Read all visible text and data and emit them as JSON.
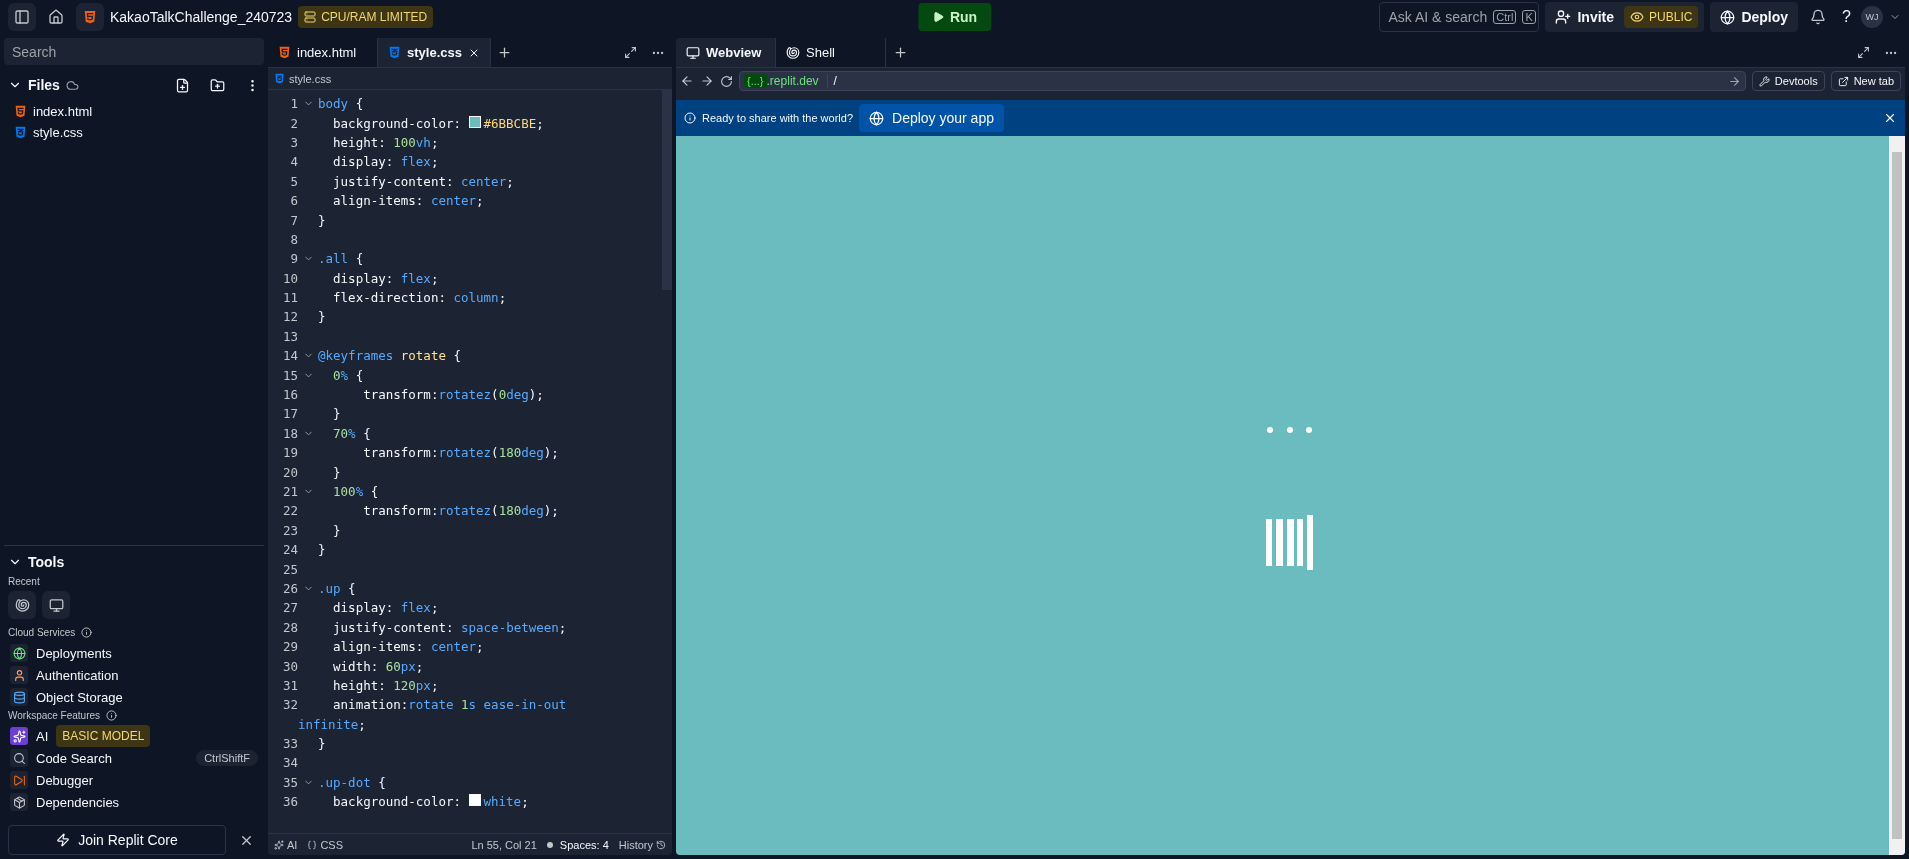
{
  "topbar": {
    "project": "KakaoTalkChallenge_240723",
    "badge": "CPU/RAM LIMITED",
    "run": "Run",
    "search": {
      "placeholder": "Ask AI & search",
      "keys": [
        "Ctrl",
        "K"
      ]
    },
    "invite": "Invite",
    "visibility": "PUBLIC",
    "deploy": "Deploy",
    "help": "?",
    "avatar": "WJ"
  },
  "sidebar": {
    "search": {
      "placeholder": "Search"
    },
    "files_title": "Files",
    "files": [
      {
        "name": "index.html",
        "kind": "html"
      },
      {
        "name": "style.css",
        "kind": "css"
      }
    ],
    "tools_title": "Tools",
    "recent_label": "Recent",
    "recent": [
      {
        "kind": "shell"
      },
      {
        "kind": "webview"
      }
    ],
    "sections": [
      {
        "title": "Cloud Services",
        "items": [
          {
            "label": "Deployments",
            "kind": "deploy"
          },
          {
            "label": "Authentication",
            "kind": "auth"
          },
          {
            "label": "Object Storage",
            "kind": "storage"
          }
        ]
      },
      {
        "title": "Workspace Features",
        "items": [
          {
            "label": "AI",
            "kind": "ai",
            "badge": "BASIC MODEL"
          },
          {
            "label": "Code Search",
            "kind": "search",
            "shortcut": "CtrlShiftF"
          },
          {
            "label": "Debugger",
            "kind": "debug"
          },
          {
            "label": "Dependencies",
            "kind": "deps"
          }
        ]
      }
    ],
    "join": "Join Replit Core"
  },
  "editor": {
    "tabs": [
      {
        "label": "index.html",
        "kind": "html",
        "selected": false
      },
      {
        "label": "style.css",
        "kind": "css",
        "selected": true
      }
    ],
    "breadcrumb": "style.css",
    "lines": [
      {
        "n": "1",
        "fold": true,
        "tokens": [
          {
            "kind": "sel",
            "text": "body"
          },
          {
            "kind": "p",
            "text": " {"
          }
        ]
      },
      {
        "n": "2",
        "fold": false,
        "tokens": [
          {
            "kind": "p",
            "text": "  background-color: "
          },
          {
            "kind": "swatch",
            "color": "#6bbcbe"
          },
          {
            "kind": "hex",
            "text": "#6BBCBE"
          },
          {
            "kind": "p",
            "text": ";"
          }
        ]
      },
      {
        "n": "3",
        "fold": false,
        "tokens": [
          {
            "kind": "p",
            "text": "  height: "
          },
          {
            "kind": "num",
            "text": "100"
          },
          {
            "kind": "val",
            "text": "vh"
          },
          {
            "kind": "p",
            "text": ";"
          }
        ]
      },
      {
        "n": "4",
        "fold": false,
        "tokens": [
          {
            "kind": "p",
            "text": "  display: "
          },
          {
            "kind": "val",
            "text": "flex"
          },
          {
            "kind": "p",
            "text": ";"
          }
        ]
      },
      {
        "n": "5",
        "fold": false,
        "tokens": [
          {
            "kind": "p",
            "text": "  justify-content: "
          },
          {
            "kind": "val",
            "text": "center"
          },
          {
            "kind": "p",
            "text": ";"
          }
        ]
      },
      {
        "n": "6",
        "fold": false,
        "tokens": [
          {
            "kind": "p",
            "text": "  align-items: "
          },
          {
            "kind": "val",
            "text": "center"
          },
          {
            "kind": "p",
            "text": ";"
          }
        ]
      },
      {
        "n": "7",
        "fold": false,
        "tokens": [
          {
            "kind": "p",
            "text": "}"
          }
        ]
      },
      {
        "n": "8",
        "fold": false
      },
      {
        "n": "9",
        "fold": true,
        "tokens": [
          {
            "kind": "sel",
            "text": ".all"
          },
          {
            "kind": "p",
            "text": " {"
          }
        ]
      },
      {
        "n": "10",
        "fold": false,
        "tokens": [
          {
            "kind": "p",
            "text": "  display: "
          },
          {
            "kind": "val",
            "text": "flex"
          },
          {
            "kind": "p",
            "text": ";"
          }
        ]
      },
      {
        "n": "11",
        "fold": false,
        "tokens": [
          {
            "kind": "p",
            "text": "  flex-direction: "
          },
          {
            "kind": "val",
            "text": "column"
          },
          {
            "kind": "p",
            "text": ";"
          }
        ]
      },
      {
        "n": "12",
        "fold": false,
        "tokens": [
          {
            "kind": "p",
            "text": "}"
          }
        ]
      },
      {
        "n": "13",
        "fold": false
      },
      {
        "n": "14",
        "fold": true,
        "tokens": [
          {
            "kind": "sel",
            "text": "@keyframes"
          },
          {
            "kind": "name",
            "text": " rotate"
          },
          {
            "kind": "p",
            "text": " {"
          }
        ]
      },
      {
        "n": "15",
        "fold": true,
        "tokens": [
          {
            "kind": "num",
            "text": "  0"
          },
          {
            "kind": "val",
            "text": "%"
          },
          {
            "kind": "p",
            "text": " {"
          }
        ]
      },
      {
        "n": "16",
        "fold": false,
        "tokens": [
          {
            "kind": "p",
            "text": "      transform:"
          },
          {
            "kind": "val",
            "text": "rotatez"
          },
          {
            "kind": "p",
            "text": "("
          },
          {
            "kind": "num",
            "text": "0"
          },
          {
            "kind": "val",
            "text": "deg"
          },
          {
            "kind": "p",
            "text": ");"
          }
        ]
      },
      {
        "n": "17",
        "fold": false,
        "tokens": [
          {
            "kind": "p",
            "text": "  }"
          }
        ]
      },
      {
        "n": "18",
        "fold": true,
        "tokens": [
          {
            "kind": "num",
            "text": "  70"
          },
          {
            "kind": "val",
            "text": "%"
          },
          {
            "kind": "p",
            "text": " {"
          }
        ]
      },
      {
        "n": "19",
        "fold": false,
        "tokens": [
          {
            "kind": "p",
            "text": "      transform:"
          },
          {
            "kind": "val",
            "text": "rotatez"
          },
          {
            "kind": "p",
            "text": "("
          },
          {
            "kind": "num",
            "text": "180"
          },
          {
            "kind": "val",
            "text": "deg"
          },
          {
            "kind": "p",
            "text": ");"
          }
        ]
      },
      {
        "n": "20",
        "fold": false,
        "tokens": [
          {
            "kind": "p",
            "text": "  }"
          }
        ]
      },
      {
        "n": "21",
        "fold": true,
        "tokens": [
          {
            "kind": "num",
            "text": "  100"
          },
          {
            "kind": "val",
            "text": "%"
          },
          {
            "kind": "p",
            "text": " {"
          }
        ]
      },
      {
        "n": "22",
        "fold": false,
        "tokens": [
          {
            "kind": "p",
            "text": "      transform:"
          },
          {
            "kind": "val",
            "text": "rotatez"
          },
          {
            "kind": "p",
            "text": "("
          },
          {
            "kind": "num",
            "text": "180"
          },
          {
            "kind": "val",
            "text": "deg"
          },
          {
            "kind": "p",
            "text": ");"
          }
        ]
      },
      {
        "n": "23",
        "fold": false,
        "tokens": [
          {
            "kind": "p",
            "text": "  }"
          }
        ]
      },
      {
        "n": "24",
        "fold": false,
        "tokens": [
          {
            "kind": "p",
            "text": "}"
          }
        ]
      },
      {
        "n": "25",
        "fold": false
      },
      {
        "n": "26",
        "fold": true,
        "tokens": [
          {
            "kind": "sel",
            "text": ".up"
          },
          {
            "kind": "p",
            "text": " {"
          }
        ]
      },
      {
        "n": "27",
        "fold": false,
        "tokens": [
          {
            "kind": "p",
            "text": "  display: "
          },
          {
            "kind": "val",
            "text": "flex"
          },
          {
            "kind": "p",
            "text": ";"
          }
        ]
      },
      {
        "n": "28",
        "fold": false,
        "tokens": [
          {
            "kind": "p",
            "text": "  justify-content: "
          },
          {
            "kind": "val",
            "text": "space-between"
          },
          {
            "kind": "p",
            "text": ";"
          }
        ]
      },
      {
        "n": "29",
        "fold": false,
        "tokens": [
          {
            "kind": "p",
            "text": "  align-items: "
          },
          {
            "kind": "val",
            "text": "center"
          },
          {
            "kind": "p",
            "text": ";"
          }
        ]
      },
      {
        "n": "30",
        "fold": false,
        "tokens": [
          {
            "kind": "p",
            "text": "  width: "
          },
          {
            "kind": "num",
            "text": "60"
          },
          {
            "kind": "val",
            "text": "px"
          },
          {
            "kind": "p",
            "text": ";"
          }
        ]
      },
      {
        "n": "31",
        "fold": false,
        "tokens": [
          {
            "kind": "p",
            "text": "  height: "
          },
          {
            "kind": "num",
            "text": "120"
          },
          {
            "kind": "val",
            "text": "px"
          },
          {
            "kind": "p",
            "text": ";"
          }
        ]
      },
      {
        "n": "32",
        "fold": false,
        "tokens": [
          {
            "kind": "p",
            "text": "  animation:"
          },
          {
            "kind": "val",
            "text": "rotate "
          },
          {
            "kind": "num",
            "text": "1"
          },
          {
            "kind": "val",
            "text": "s ease-in-out"
          }
        ],
        "wrap": [
          {
            "kind": "val",
            "text": "infinite"
          },
          {
            "kind": "p",
            "text": ";"
          }
        ]
      },
      {
        "n": "33",
        "fold": false,
        "tokens": [
          {
            "kind": "p",
            "text": "}"
          }
        ]
      },
      {
        "n": "34",
        "fold": false
      },
      {
        "n": "35",
        "fold": true,
        "tokens": [
          {
            "kind": "sel",
            "text": ".up-dot"
          },
          {
            "kind": "p",
            "text": " {"
          }
        ]
      },
      {
        "n": "36",
        "fold": false,
        "tokens": [
          {
            "kind": "p",
            "text": "  background-color: "
          },
          {
            "kind": "swatch",
            "color": "#ffffff"
          },
          {
            "kind": "val",
            "text": "white"
          },
          {
            "kind": "p",
            "text": ";"
          }
        ]
      }
    ],
    "status": {
      "ai": "AI",
      "language": "CSS",
      "position": "Ln 55, Col 21",
      "spaces": "Spaces: 4",
      "history": "History"
    }
  },
  "preview": {
    "tabs": [
      {
        "label": "Webview",
        "kind": "webview",
        "selected": true
      },
      {
        "label": "Shell",
        "kind": "shell",
        "selected": false
      }
    ],
    "url_badge": "{...}",
    "url_host": ".replit.dev",
    "url_path": "/",
    "devtools": "Devtools",
    "new_tab": "New tab",
    "banner": {
      "text": "Ready to share with the world?",
      "button": "Deploy your app"
    }
  }
}
